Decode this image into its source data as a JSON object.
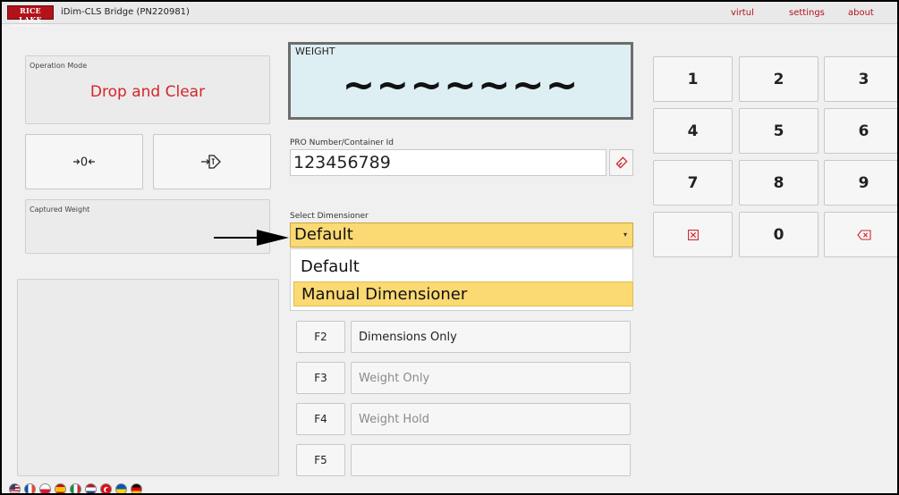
{
  "titlebar": {
    "logo_line1": "RICE LAKE",
    "logo_line2": "WEIGHING SYSTEMS",
    "app_title": "iDim-CLS Bridge (PN220981)",
    "links": [
      "virtul",
      "settings",
      "about"
    ]
  },
  "operation": {
    "label": "Operation Mode",
    "value": "Drop and Clear"
  },
  "scale_buttons": {
    "zero_icon": "+0+",
    "tare_icon": "+T+"
  },
  "captured_weight": {
    "label": "Captured Weight",
    "value": ""
  },
  "weight": {
    "label": "WEIGHT",
    "value": "~~~~~~~"
  },
  "pro": {
    "label": "PRO Number/Container Id",
    "value": "123456789"
  },
  "dimensioner": {
    "label": "Select Dimensioner",
    "selected": "Default",
    "options": [
      "Default",
      "Manual Dimensioner"
    ]
  },
  "function_keys": [
    {
      "key": "F2",
      "label": "Dimensions Only"
    },
    {
      "key": "F3",
      "label": "Weight Only"
    },
    {
      "key": "F4",
      "label": "Weight Hold"
    },
    {
      "key": "F5",
      "label": ""
    }
  ],
  "keypad": [
    "1",
    "2",
    "3",
    "4",
    "5",
    "6",
    "7",
    "8",
    "9",
    "0"
  ],
  "flags": [
    "us",
    "fr",
    "pl",
    "es",
    "it",
    "nl",
    "tr",
    "ua",
    "de"
  ],
  "colors": {
    "accent_red": "#b3121a",
    "highlight_yellow": "#fbd973",
    "weight_bg": "#ddeff2"
  }
}
